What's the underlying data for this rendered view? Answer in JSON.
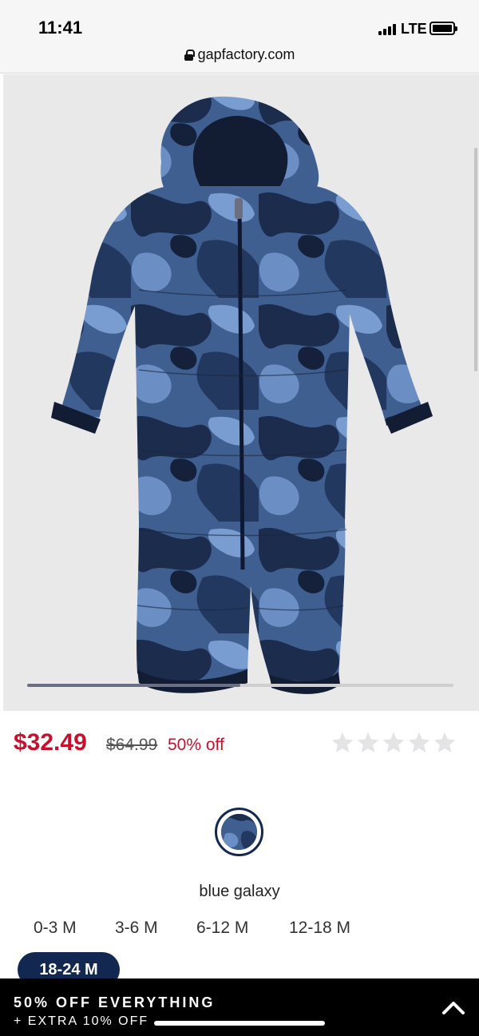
{
  "status_bar": {
    "time": "11:41",
    "network": "LTE"
  },
  "browser": {
    "url": "gapfactory.com"
  },
  "product": {
    "sale_price": "$32.49",
    "original_price": "$64.99",
    "discount": "50% off",
    "rating_stars": 5,
    "image_carousel_progress": 0.5,
    "color": {
      "name": "blue galaxy",
      "swatch_hex": "#2e4b7a"
    },
    "sizes": [
      "0-3 M",
      "3-6 M",
      "6-12 M",
      "12-18 M",
      "18-24 M"
    ],
    "selected_size": "18-24 M"
  },
  "promo": {
    "title": "50% OFF EVERYTHING",
    "subtitle": "+ EXTRA 10% OFF"
  },
  "colors": {
    "sale_red": "#c8102e",
    "navy": "#122850",
    "image_bg": "#e9e9ea",
    "promo_bg": "#000000"
  },
  "icons": [
    "lock-icon",
    "signal-icon",
    "battery-icon",
    "star-icon",
    "chevron-up-icon"
  ]
}
